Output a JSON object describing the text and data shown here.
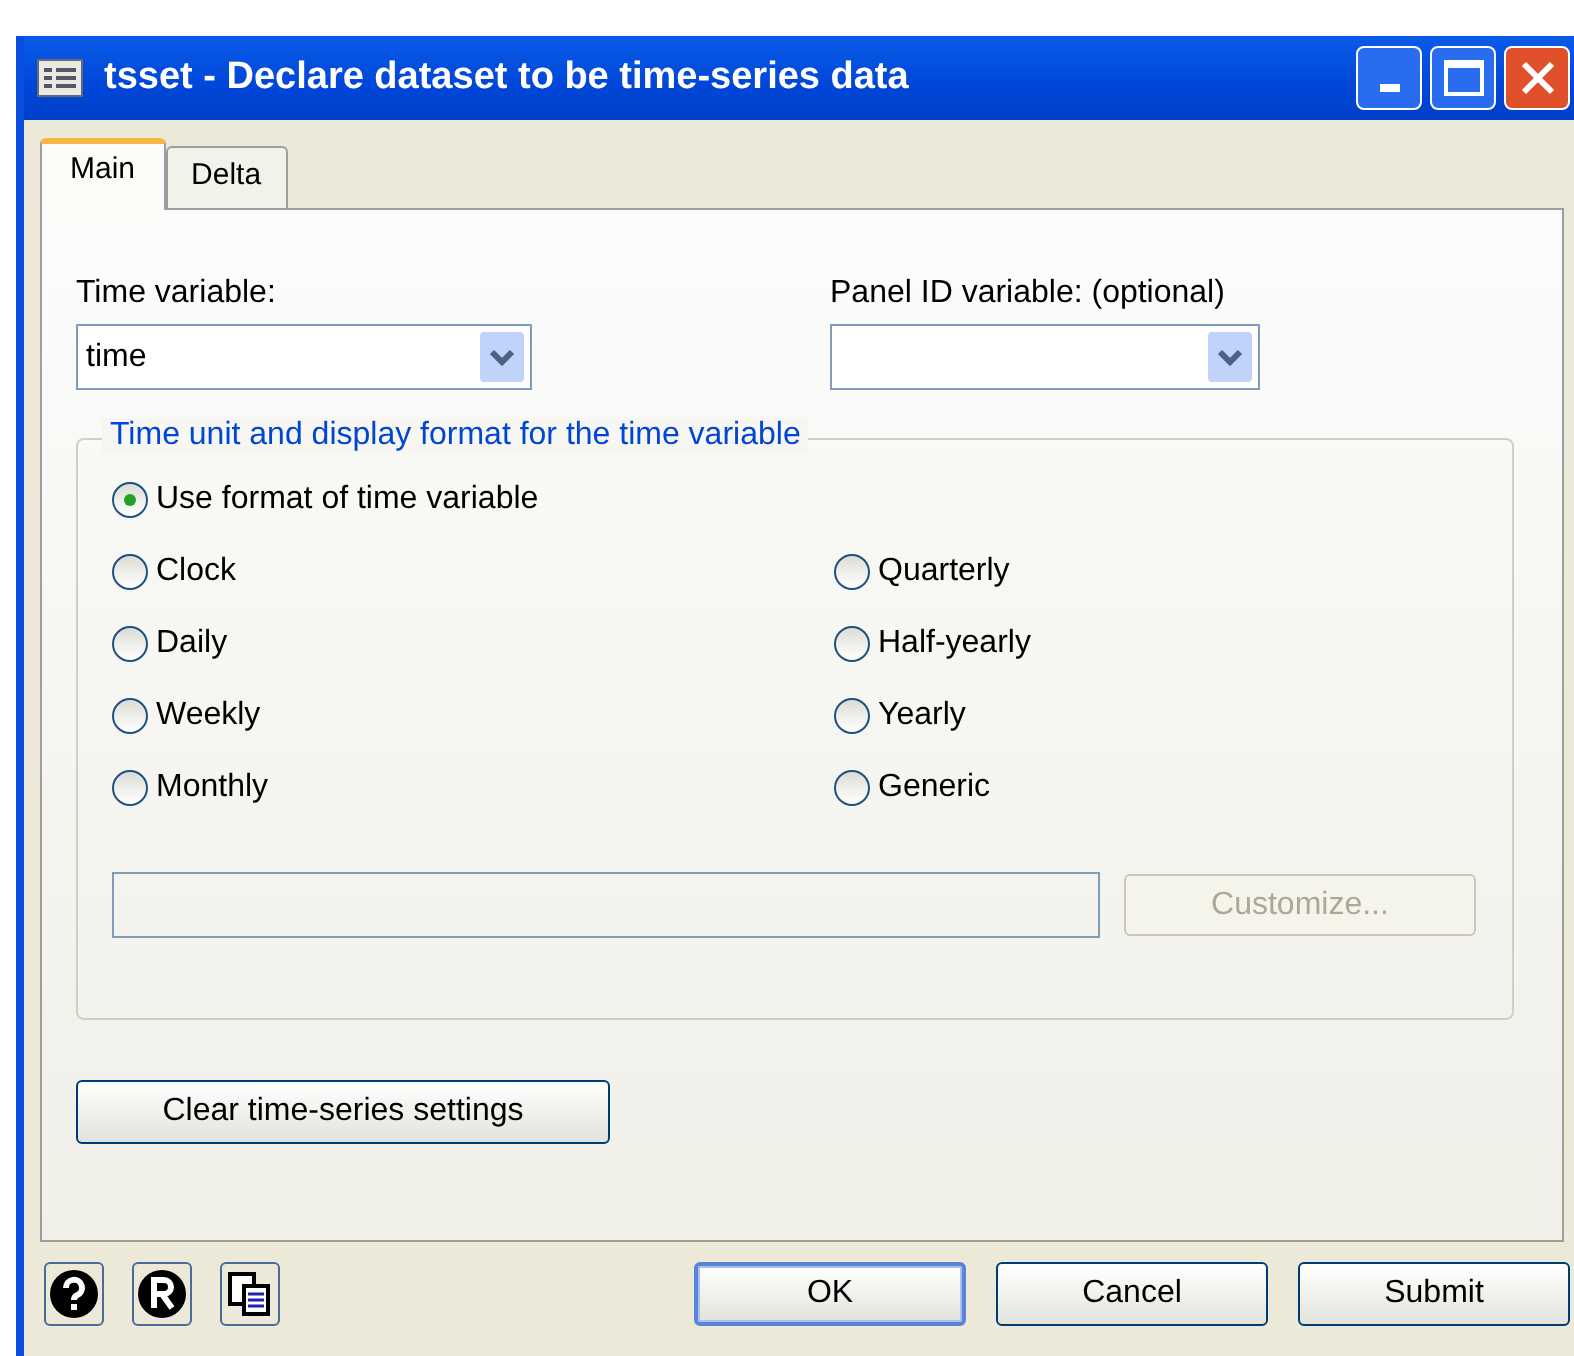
{
  "window": {
    "title": "tsset - Declare dataset to be time-series data"
  },
  "tabs": [
    {
      "label": "Main",
      "selected": true
    },
    {
      "label": "Delta",
      "selected": false
    }
  ],
  "time_variable": {
    "label": "Time variable:",
    "value": "time"
  },
  "panel_id_variable": {
    "label": "Panel ID variable:  (optional)"
  },
  "time_unit_group": {
    "title": "Time unit and display format for the time variable",
    "first_option": {
      "label": "Use format of time variable",
      "selected": true
    },
    "left_column": [
      {
        "label": "Clock",
        "selected": false
      },
      {
        "label": "Daily",
        "selected": false
      },
      {
        "label": "Weekly",
        "selected": false
      },
      {
        "label": "Monthly",
        "selected": false
      }
    ],
    "right_column": [
      {
        "label": "Quarterly",
        "selected": false
      },
      {
        "label": "Half-yearly",
        "selected": false
      },
      {
        "label": "Yearly",
        "selected": false
      },
      {
        "label": "Generic",
        "selected": false
      }
    ],
    "customize_button": {
      "label": "Customize...",
      "disabled": true
    }
  },
  "clear_button": {
    "label": "Clear time-series settings"
  },
  "footer_icons": [
    {
      "kind": "help"
    },
    {
      "kind": "reset"
    },
    {
      "kind": "copy"
    }
  ],
  "buttons": [
    {
      "label": "OK",
      "default": true
    },
    {
      "label": "Cancel",
      "default": false
    },
    {
      "label": "Submit",
      "default": false
    }
  ]
}
